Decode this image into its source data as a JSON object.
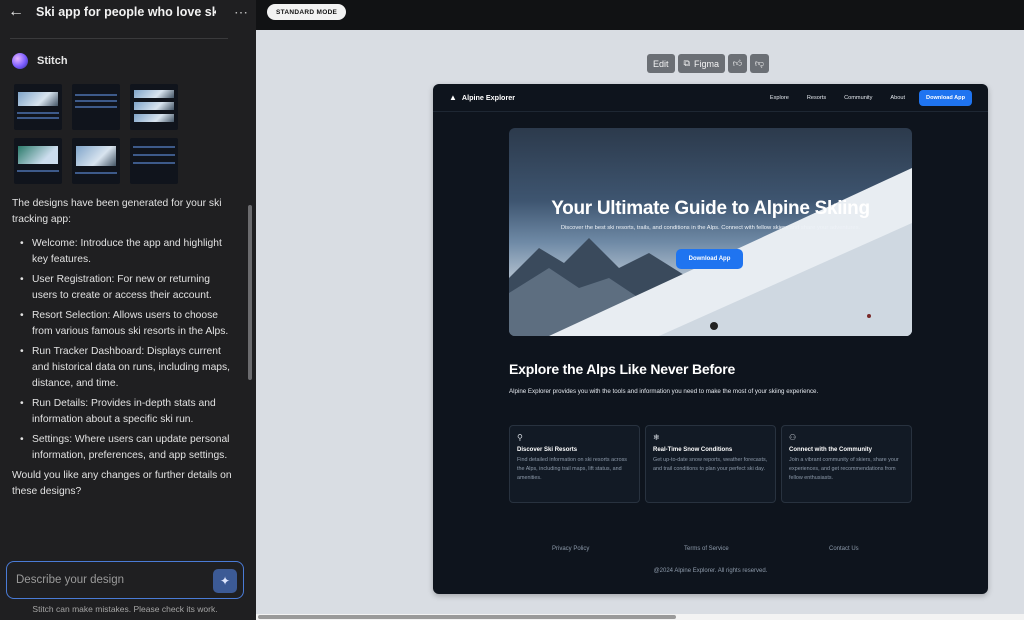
{
  "header": {
    "back_icon": "arrow-left-icon",
    "project_title": "Ski app for people who love ski...",
    "more_icon": "more-horizontal-icon"
  },
  "agent": {
    "name": "Stitch"
  },
  "message": {
    "intro": "The designs have been generated for your ski tracking app:",
    "items": [
      "Welcome: Introduce the app and highlight key features.",
      "User Registration: For new or returning users to create or access their account.",
      "Resort Selection: Allows users to choose from various famous ski resorts in the Alps.",
      "Run Tracker Dashboard: Displays current and historical data on runs, including maps, distance, and time.",
      "Run Details: Provides in-depth stats and information about a specific ski run.",
      "Settings: Where users can update personal information, preferences, and app settings."
    ],
    "outro": "Would you like any changes or further details on these designs?"
  },
  "prompt": {
    "placeholder": "Describe your design",
    "disclaimer": "Stitch can make mistakes. Please check its work."
  },
  "topbar": {
    "mode_label": "STANDARD MODE"
  },
  "toolbar": {
    "edit_label": "Edit",
    "figma_label": "Figma"
  },
  "preview": {
    "brand": "Alpine Explorer",
    "nav": [
      "Explore",
      "Resorts",
      "Community",
      "About"
    ],
    "nav_cta": "Download App",
    "hero_title": "Your Ultimate Guide to Alpine Skiing",
    "hero_subtitle": "Discover the best ski resorts, trails, and conditions in the Alps. Connect with fellow skiers and share your adventures.",
    "hero_button": "Download App",
    "section_title": "Explore the Alps Like Never Before",
    "section_desc": "Alpine Explorer provides you with the tools and information you need to make the most of your skiing experience.",
    "cards": [
      {
        "icon": "map-pin-icon",
        "title": "Discover Ski Resorts",
        "desc": "Find detailed information on ski resorts across the Alps, including trail maps, lift status, and amenities."
      },
      {
        "icon": "snowflake-icon",
        "title": "Real-Time Snow Conditions",
        "desc": "Get up-to-date snow reports, weather forecasts, and trail conditions to plan your perfect ski day."
      },
      {
        "icon": "users-icon",
        "title": "Connect with the Community",
        "desc": "Join a vibrant community of skiers, share your experiences, and get recommendations from fellow enthusiasts."
      }
    ],
    "footer_links": [
      "Privacy Policy",
      "Terms of Service",
      "Contact Us"
    ],
    "copyright": "@2024 Alpine Explorer. All rights reserved."
  }
}
